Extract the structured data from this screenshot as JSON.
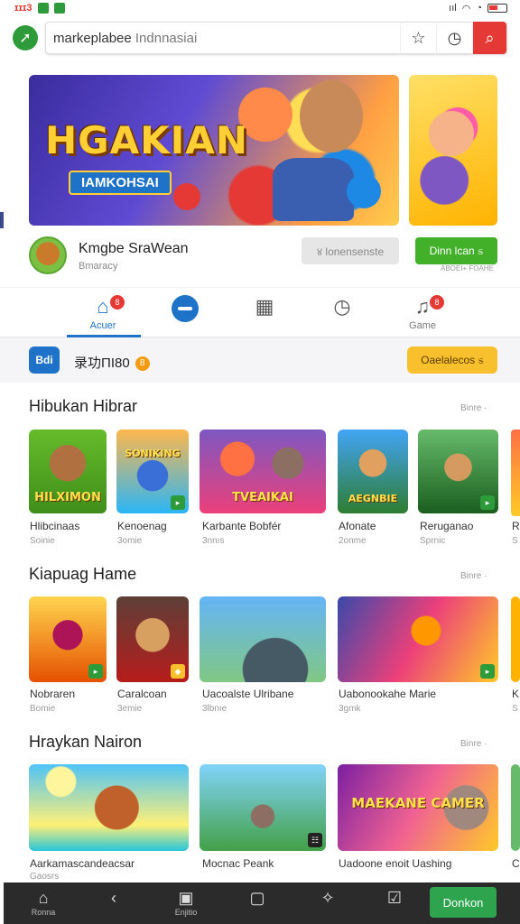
{
  "status": {
    "left": "ɪɪɪ3",
    "right": "ııl"
  },
  "search": {
    "query": "markeplabee",
    "hint": "Indnnasiai"
  },
  "banner": {
    "title": "HGAKIAN",
    "subtitle": "IAMKOHSAI"
  },
  "app": {
    "name": "Kmgbe SraWean",
    "sub": "Bmaracy",
    "btn_secondary": "४ lonensenste",
    "btn_primary": "Dinn lcan  ಽ",
    "tiny": "ABOEI+ FOAHE"
  },
  "tabs": [
    {
      "label": "Acuer",
      "icon": "home-icon",
      "badge": "8"
    },
    {
      "label": "",
      "icon": "chat-icon",
      "badge": ""
    },
    {
      "label": "",
      "icon": "grid-icon",
      "badge": ""
    },
    {
      "label": "",
      "icon": "clock-icon",
      "badge": ""
    },
    {
      "label": "Game",
      "icon": "bell-icon",
      "badge": "8"
    }
  ],
  "promo": {
    "logo": "Bdi",
    "text": "录功ΠI80",
    "dot": "8",
    "button": "Oaelalecos  ಽ"
  },
  "sections": [
    {
      "title": "Hibukan Hibrar",
      "more": "Binre ·",
      "items": [
        {
          "name": "Hlibcinaas",
          "sub": "Soinie",
          "caption": "HILXIMON"
        },
        {
          "name": "Kenoenag",
          "sub": "3omie",
          "caption": "SONIKING"
        },
        {
          "name": "Karbante Bobfér",
          "sub": "3nnıs",
          "caption": "TVEAIKAI"
        },
        {
          "name": "Afonate",
          "sub": "2onme",
          "caption": "AEGNBIE"
        },
        {
          "name": "Reruganao",
          "sub": "Sprnic",
          "caption": ""
        },
        {
          "name": "R",
          "sub": "S",
          "caption": ""
        }
      ]
    },
    {
      "title": "Kiapuag Hame",
      "more": "Binre ·",
      "items": [
        {
          "name": "Nobraren",
          "sub": "Bomie",
          "caption": ""
        },
        {
          "name": "Caralcoan",
          "sub": "3emie",
          "caption": ""
        },
        {
          "name": "Uacoalste Ulribane",
          "sub": "3lbnıe",
          "caption": ""
        },
        {
          "name": "Uabonookahe Marie",
          "sub": "3gmk",
          "caption": ""
        },
        {
          "name": "K",
          "sub": "S",
          "caption": ""
        }
      ]
    },
    {
      "title": "Hraykan Nairon",
      "more": "Binre ·",
      "items": [
        {
          "name": "Aarkamascandeacsar",
          "sub": "Gaosrs",
          "caption": ""
        },
        {
          "name": "Mocnac Peank",
          "sub": "",
          "caption": ""
        },
        {
          "name": "Uadoone enoit Uashing",
          "sub": "",
          "caption": "MAEKANE CAMER"
        },
        {
          "name": "C",
          "sub": "",
          "caption": ""
        }
      ]
    }
  ],
  "bottom": [
    {
      "label": "Ronna",
      "icon": "home-icon"
    },
    {
      "label": "",
      "icon": "back-icon"
    },
    {
      "label": "Enjitio",
      "icon": "calendar-icon"
    },
    {
      "label": "",
      "icon": "square-icon"
    },
    {
      "label": "",
      "icon": "star-icon"
    },
    {
      "label": "",
      "icon": "check-icon"
    }
  ],
  "bottom_button": "Donkon",
  "colors": {
    "accent": "#1e73c8",
    "green": "#43b02a",
    "red": "#e53935",
    "yellow": "#f9c02e"
  }
}
